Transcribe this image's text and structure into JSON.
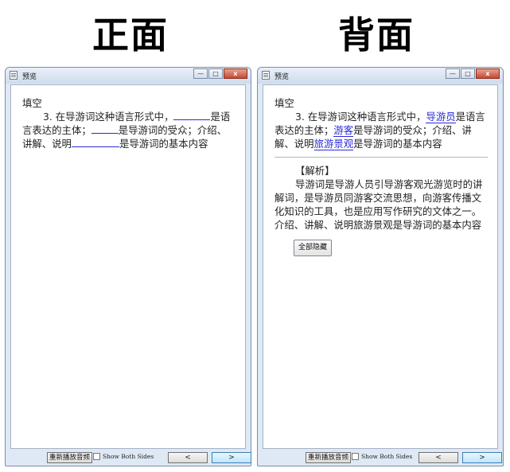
{
  "front_heading": "正面",
  "back_heading": "背面",
  "window": {
    "title": "预览",
    "min_symbol": "—",
    "max_symbol": "□",
    "close_symbol": "x"
  },
  "card": {
    "type_label": "填空",
    "question_number": "3.",
    "front": {
      "text_1": "在导游词这种语言形式中，",
      "text_2": "是语言表达的主体；",
      "text_3": "是导游词的受众；介绍、讲解、说明",
      "text_4": "是导游词的基本内容"
    },
    "back": {
      "text_1": "在导游词这种语言形式中，",
      "answer_1": "导游员",
      "text_2": "是语言表达的主体；",
      "answer_2": "游客",
      "text_3": "是导游词的受众；介绍、讲解、说明",
      "answer_3": "旅游景观",
      "text_4": "是导游词的基本内容",
      "analysis_title": "【解析】",
      "analysis_text": "导游词是导游人员引导游客观光游览时的讲解词，是导游员同游客交流思想，向游客传播文化知识的工具，也是应用写作研究的文体之一。介绍、讲解、说明旅游景观是导游词的基本内容",
      "hide_all_label": "全部隐藏"
    }
  },
  "bottom": {
    "replay_label": "重新播放音频",
    "show_both_label": "Show Both Sides",
    "prev_label": "<",
    "next_label": ">"
  },
  "colors": {
    "answer": "#2a2ad8",
    "window_frame": "#dfe9f5"
  }
}
